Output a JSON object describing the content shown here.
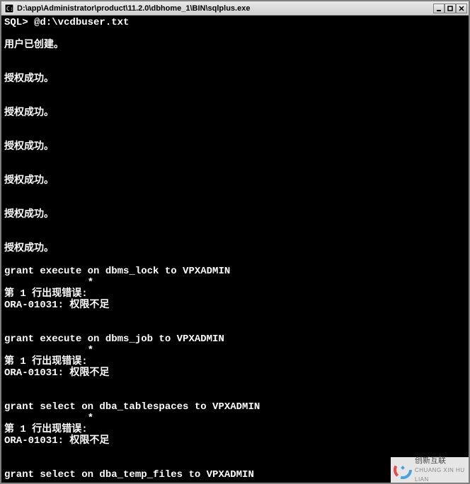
{
  "titlebar": {
    "path": "D:\\app\\Administrator\\product\\11.2.0\\dbhome_1\\BIN\\sqlplus.exe"
  },
  "terminal": {
    "lines": [
      "SQL> @d:\\vcdbuser.txt",
      "",
      "用户已创建。",
      "",
      "",
      "授权成功。",
      "",
      "",
      "授权成功。",
      "",
      "",
      "授权成功。",
      "",
      "",
      "授权成功。",
      "",
      "",
      "授权成功。",
      "",
      "",
      "授权成功。",
      "",
      "grant execute on dbms_lock to VPXADMIN",
      "              *",
      "第 1 行出现错误:",
      "ORA-01031: 权限不足",
      "",
      "",
      "grant execute on dbms_job to VPXADMIN",
      "              *",
      "第 1 行出现错误:",
      "ORA-01031: 权限不足",
      "",
      "",
      "grant select on dba_tablespaces to VPXADMIN",
      "              *",
      "第 1 行出现错误:",
      "ORA-01031: 权限不足",
      "",
      "",
      "grant select on dba_temp_files to VPXADMIN"
    ]
  },
  "watermark": {
    "main": "创新互联",
    "sub": "CHUANG XIN HU LIAN"
  }
}
